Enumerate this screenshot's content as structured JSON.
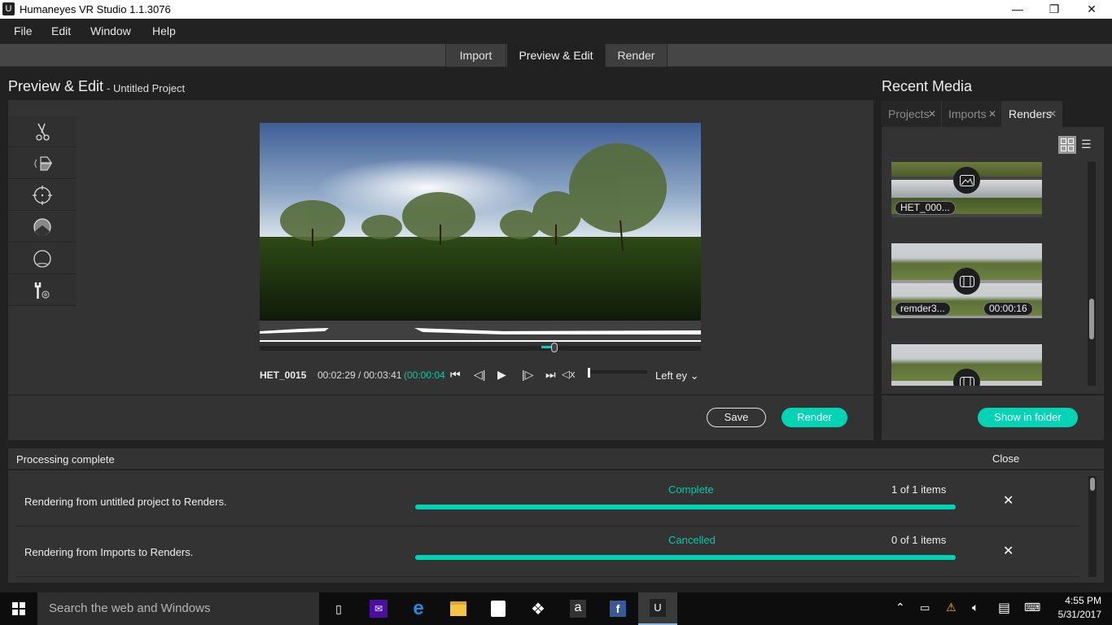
{
  "window": {
    "title": "Humaneyes VR Studio 1.1.3076",
    "logo_glyph": "U",
    "controls": {
      "minimize": "—",
      "maximize": "❐",
      "close": "✕"
    }
  },
  "menu": [
    "File",
    "Edit",
    "Window",
    "Help"
  ],
  "mode_tabs": [
    {
      "label": "Import",
      "active": false
    },
    {
      "label": "Preview & Edit",
      "active": true
    },
    {
      "label": "Render",
      "active": false
    }
  ],
  "editor": {
    "title": "Preview & Edit",
    "project": "- Untitled Project",
    "tools": [
      "scissors-icon",
      "flip-icon",
      "crosshair-icon",
      "horizon-icon",
      "nadir-icon",
      "settings-wrench-icon"
    ],
    "player": {
      "clip_name": "HET_0015",
      "time": "00:02:29 / 00:03:41",
      "duration_selection": "(00:00:04",
      "eye_select": "Left ey",
      "playhead_fraction": 0.67,
      "volume_fraction": 0.0
    },
    "save_label": "Save",
    "render_label": "Render"
  },
  "recent_media": {
    "title": "Recent Media",
    "tabs": [
      {
        "label": "Projects",
        "active": false
      },
      {
        "label": "Imports",
        "active": false
      },
      {
        "label": "Renders",
        "active": true
      }
    ],
    "items": [
      {
        "name": "HET_000...",
        "type": "image",
        "duration": ""
      },
      {
        "name": "remder3...",
        "type": "video",
        "duration": "00:00:16"
      },
      {
        "name": "",
        "type": "video",
        "duration": ""
      }
    ],
    "show_in_folder_label": "Show in folder"
  },
  "processing": {
    "title": "Processing complete",
    "close_label": "Close",
    "jobs": [
      {
        "description": "Rendering from untitled project to Renders.",
        "status": "Complete",
        "count": "1 of 1 items",
        "progress": 1.0
      },
      {
        "description": "Rendering from Imports to Renders.",
        "status": "Cancelled",
        "count": "0 of 1 items",
        "progress": 1.0
      }
    ]
  },
  "taskbar": {
    "search_placeholder": "Search the web and Windows",
    "time": "4:55 PM",
    "date": "5/31/2017"
  },
  "colors": {
    "accent": "#00d4b4",
    "panel": "#333333",
    "background": "#212121"
  }
}
